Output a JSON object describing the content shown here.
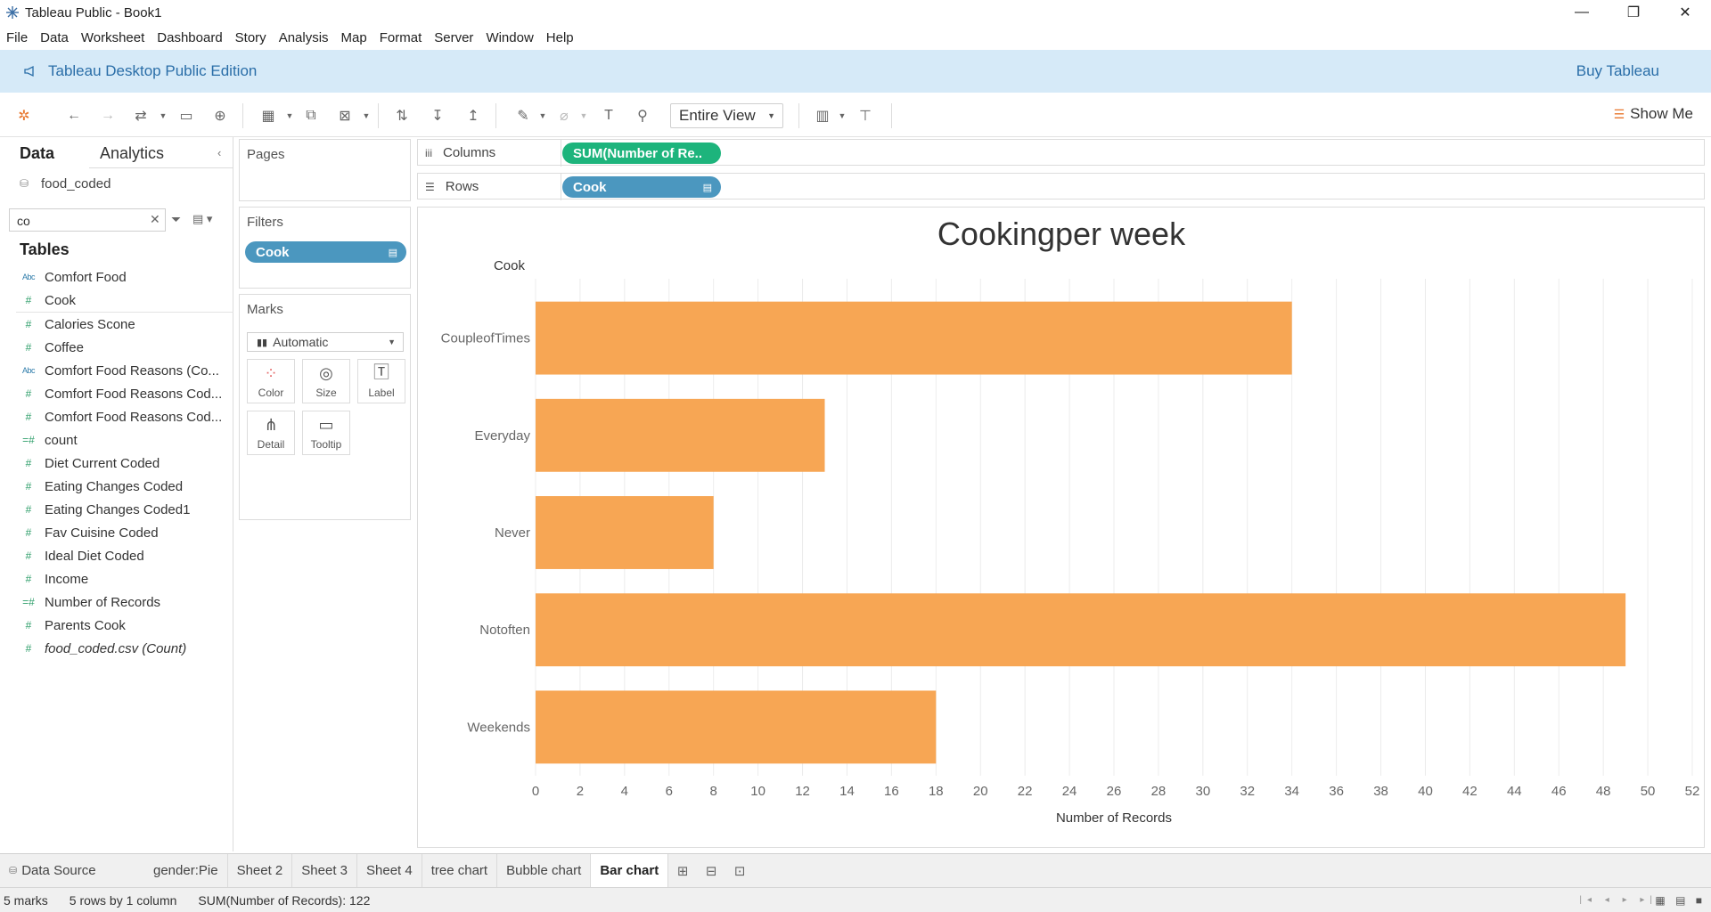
{
  "window": {
    "title": "Tableau Public - Book1",
    "minimize": "—",
    "restore": "❐",
    "close": "✕"
  },
  "menu": [
    "File",
    "Data",
    "Worksheet",
    "Dashboard",
    "Story",
    "Analysis",
    "Map",
    "Format",
    "Server",
    "Window",
    "Help"
  ],
  "banner": {
    "text": "Tableau Desktop Public Edition",
    "buy": "Buy Tableau"
  },
  "toolbar": {
    "fit_mode": "Entire View",
    "show_me": "Show Me"
  },
  "data_pane": {
    "tab_data": "Data",
    "tab_analytics": "Analytics",
    "datasource": "food_coded",
    "search_value": "co",
    "tables_header": "Tables",
    "fields": [
      {
        "type": "Abc",
        "label": "Comfort Food"
      },
      {
        "type": "#",
        "label": "Cook"
      },
      {
        "type": "#",
        "label": "Calories Scone"
      },
      {
        "type": "#",
        "label": "Coffee"
      },
      {
        "type": "Abc",
        "label": "Comfort Food Reasons (Co..."
      },
      {
        "type": "#",
        "label": "Comfort Food Reasons Cod..."
      },
      {
        "type": "#",
        "label": "Comfort Food Reasons Cod..."
      },
      {
        "type": "=#",
        "label": "count"
      },
      {
        "type": "#",
        "label": "Diet Current Coded"
      },
      {
        "type": "#",
        "label": "Eating Changes Coded"
      },
      {
        "type": "#",
        "label": "Eating Changes Coded1"
      },
      {
        "type": "#",
        "label": "Fav Cuisine Coded"
      },
      {
        "type": "#",
        "label": "Ideal Diet Coded"
      },
      {
        "type": "#",
        "label": "Income"
      },
      {
        "type": "=#",
        "label": "Number of Records"
      },
      {
        "type": "#",
        "label": "Parents Cook"
      },
      {
        "type": "#",
        "label": "food_coded.csv (Count)"
      }
    ]
  },
  "pages": {
    "title": "Pages"
  },
  "filters": {
    "title": "Filters",
    "pill": "Cook"
  },
  "marks": {
    "title": "Marks",
    "type": "Automatic",
    "buttons": [
      "Color",
      "Size",
      "Label",
      "Detail",
      "Tooltip"
    ]
  },
  "shelves": {
    "columns_label": "Columns",
    "columns_pill": "SUM(Number of Re..",
    "rows_label": "Rows",
    "rows_pill": "Cook"
  },
  "colors": {
    "bar": "#f7a654",
    "pill_blue": "#4b97bf",
    "pill_green": "#1db47c",
    "banner": "#d6eaf8"
  },
  "chart_data": {
    "type": "bar",
    "orientation": "horizontal",
    "title": "Cookingper week",
    "row_header": "Cook",
    "categories": [
      "CoupleofTimes",
      "Everyday",
      "Never",
      "Notoften",
      "Weekends"
    ],
    "values": [
      34,
      13,
      8,
      49,
      18
    ],
    "xlabel": "Number of Records",
    "xlim": [
      0,
      52
    ],
    "xticks": [
      0,
      2,
      4,
      6,
      8,
      10,
      12,
      14,
      16,
      18,
      20,
      22,
      24,
      26,
      28,
      30,
      32,
      34,
      36,
      38,
      40,
      42,
      44,
      46,
      48,
      50,
      52
    ],
    "grid": "vertical"
  },
  "sheet_tabs": {
    "datasource": "Data Source",
    "tabs": [
      "gender:Pie",
      "Sheet 2",
      "Sheet 3",
      "Sheet 4",
      "tree chart",
      "Bubble chart",
      "Bar chart"
    ],
    "active": "Bar chart"
  },
  "status": {
    "marks": "5 marks",
    "rows": "5 rows by 1 column",
    "sum": "SUM(Number of Records): 122"
  }
}
